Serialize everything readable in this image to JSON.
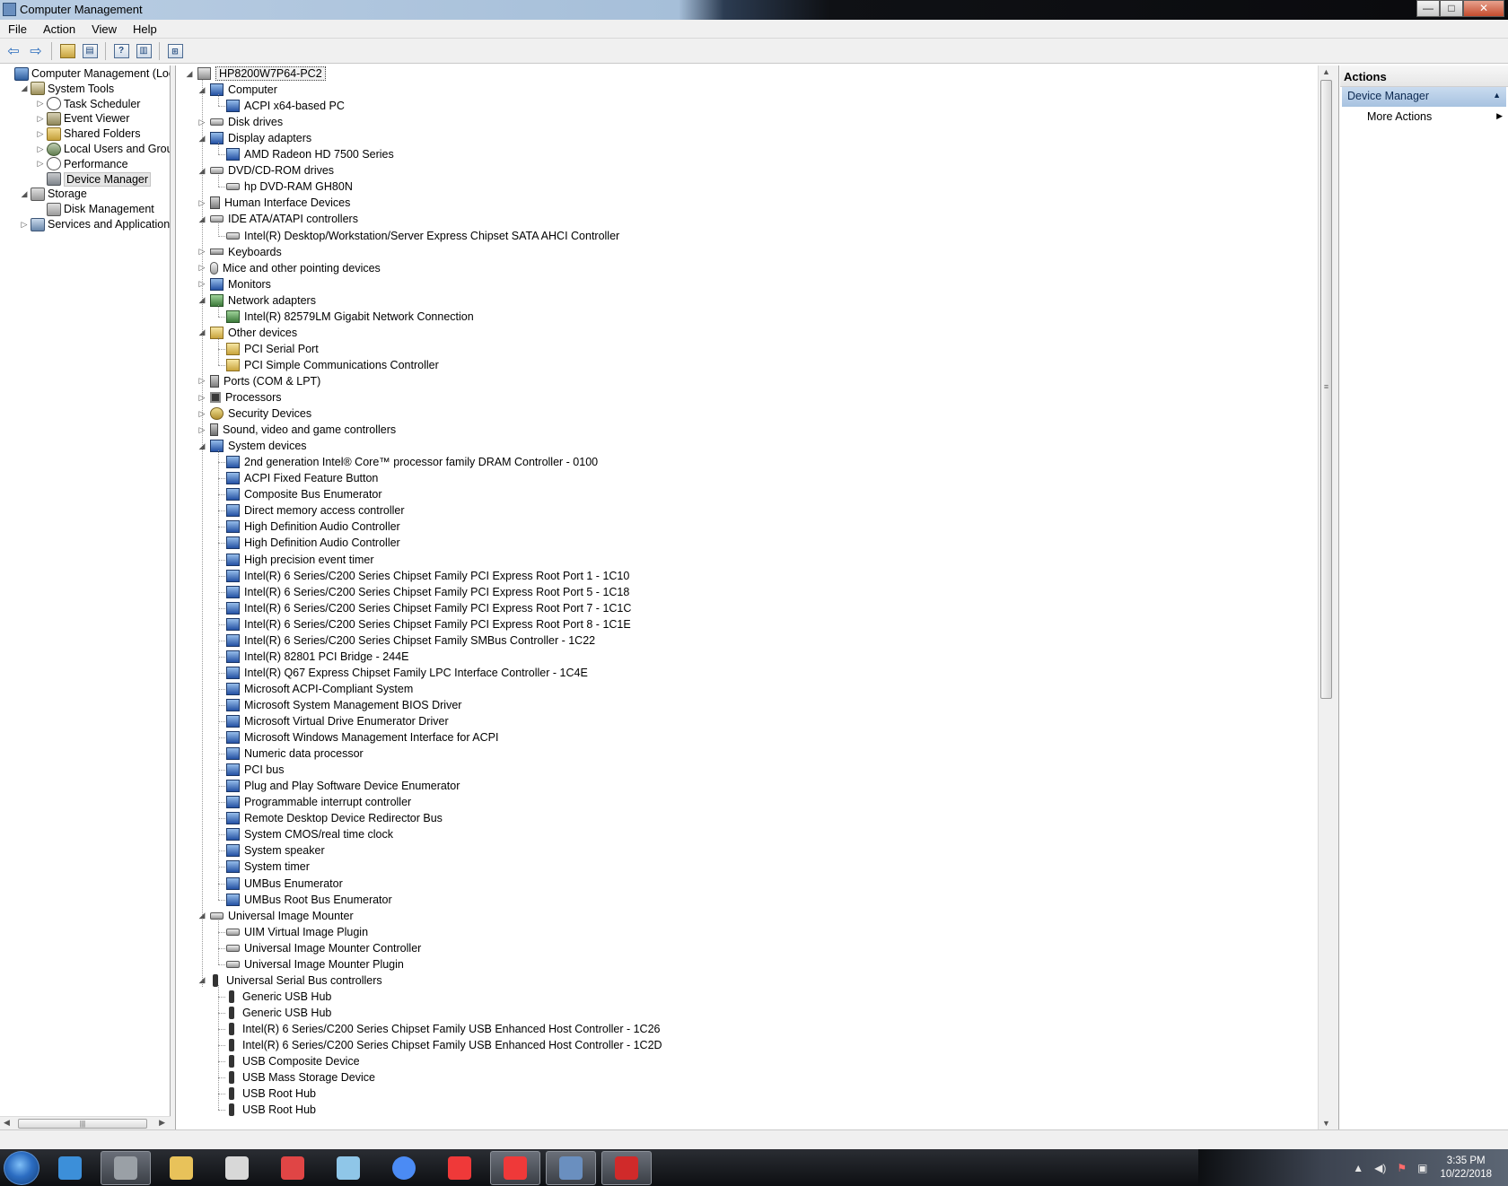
{
  "window": {
    "title": "Computer Management",
    "controls": {
      "minimize": "—",
      "maximize": "□",
      "close": "✕"
    }
  },
  "menu": [
    "File",
    "Action",
    "View",
    "Help"
  ],
  "toolbar": {
    "icons": [
      "back-arrow-icon",
      "forward-arrow-icon",
      "up-folder-icon",
      "show-hide-console-tree-icon",
      "help-icon",
      "show-hide-action-pane-icon",
      "scan-hardware-icon"
    ]
  },
  "left_tree": [
    {
      "label": "Computer Management (Local",
      "level": 0,
      "expander": "",
      "icon": "computer-management-icon"
    },
    {
      "label": "System Tools",
      "level": 1,
      "expander": "◢",
      "icon": "system-tools-icon"
    },
    {
      "label": "Task Scheduler",
      "level": 2,
      "expander": "▷",
      "icon": "task-scheduler-icon"
    },
    {
      "label": "Event Viewer",
      "level": 2,
      "expander": "▷",
      "icon": "event-viewer-icon"
    },
    {
      "label": "Shared Folders",
      "level": 2,
      "expander": "▷",
      "icon": "shared-folders-icon"
    },
    {
      "label": "Local Users and Groups",
      "level": 2,
      "expander": "▷",
      "icon": "local-users-icon"
    },
    {
      "label": "Performance",
      "level": 2,
      "expander": "▷",
      "icon": "performance-icon"
    },
    {
      "label": "Device Manager",
      "level": 2,
      "expander": "",
      "icon": "device-manager-icon",
      "selected": true
    },
    {
      "label": "Storage",
      "level": 1,
      "expander": "◢",
      "icon": "storage-icon"
    },
    {
      "label": "Disk Management",
      "level": 2,
      "expander": "",
      "icon": "disk-management-icon"
    },
    {
      "label": "Services and Applications",
      "level": 1,
      "expander": "▷",
      "icon": "services-icon"
    }
  ],
  "device_tree": {
    "root": "HP8200W7P64-PC2",
    "rows": [
      {
        "label": "Computer",
        "level": 1,
        "expander": "◢",
        "icon": "computer-icon"
      },
      {
        "label": "ACPI x64-based PC",
        "level": 2,
        "icon": "computer-icon"
      },
      {
        "label": "Disk drives",
        "level": 1,
        "expander": "▷",
        "icon": "disk-drive-icon"
      },
      {
        "label": "Display adapters",
        "level": 1,
        "expander": "◢",
        "icon": "display-adapter-icon"
      },
      {
        "label": "AMD Radeon HD 7500 Series",
        "level": 2,
        "icon": "display-adapter-icon"
      },
      {
        "label": "DVD/CD-ROM drives",
        "level": 1,
        "expander": "◢",
        "icon": "dvd-drive-icon"
      },
      {
        "label": "hp DVD-RAM GH80N",
        "level": 2,
        "icon": "dvd-drive-icon"
      },
      {
        "label": "Human Interface Devices",
        "level": 1,
        "expander": "▷",
        "icon": "hid-icon"
      },
      {
        "label": "IDE ATA/ATAPI controllers",
        "level": 1,
        "expander": "◢",
        "icon": "ide-controller-icon"
      },
      {
        "label": "Intel(R) Desktop/Workstation/Server Express Chipset SATA AHCI Controller",
        "level": 2,
        "icon": "ide-controller-icon"
      },
      {
        "label": "Keyboards",
        "level": 1,
        "expander": "▷",
        "icon": "keyboard-icon"
      },
      {
        "label": "Mice and other pointing devices",
        "level": 1,
        "expander": "▷",
        "icon": "mouse-icon"
      },
      {
        "label": "Monitors",
        "level": 1,
        "expander": "▷",
        "icon": "monitor-icon"
      },
      {
        "label": "Network adapters",
        "level": 1,
        "expander": "◢",
        "icon": "network-adapter-icon"
      },
      {
        "label": "Intel(R) 82579LM Gigabit Network Connection",
        "level": 2,
        "icon": "network-adapter-icon"
      },
      {
        "label": "Other devices",
        "level": 1,
        "expander": "◢",
        "icon": "other-devices-icon"
      },
      {
        "label": "PCI Serial Port",
        "level": 2,
        "icon": "unknown-device-icon"
      },
      {
        "label": "PCI Simple Communications Controller",
        "level": 2,
        "icon": "unknown-device-icon"
      },
      {
        "label": "Ports (COM & LPT)",
        "level": 1,
        "expander": "▷",
        "icon": "port-icon"
      },
      {
        "label": "Processors",
        "level": 1,
        "expander": "▷",
        "icon": "processor-icon"
      },
      {
        "label": "Security Devices",
        "level": 1,
        "expander": "▷",
        "icon": "security-device-icon"
      },
      {
        "label": "Sound, video and game controllers",
        "level": 1,
        "expander": "▷",
        "icon": "sound-icon"
      },
      {
        "label": "System devices",
        "level": 1,
        "expander": "◢",
        "icon": "system-device-icon"
      },
      {
        "label": "2nd generation Intel® Core™ processor family DRAM Controller - 0100",
        "level": 2,
        "icon": "system-device-icon"
      },
      {
        "label": "ACPI Fixed Feature Button",
        "level": 2,
        "icon": "system-device-icon"
      },
      {
        "label": "Composite Bus Enumerator",
        "level": 2,
        "icon": "system-device-icon"
      },
      {
        "label": "Direct memory access controller",
        "level": 2,
        "icon": "system-device-icon"
      },
      {
        "label": "High Definition Audio Controller",
        "level": 2,
        "icon": "system-device-icon"
      },
      {
        "label": "High Definition Audio Controller",
        "level": 2,
        "icon": "system-device-icon"
      },
      {
        "label": "High precision event timer",
        "level": 2,
        "icon": "system-device-icon"
      },
      {
        "label": "Intel(R) 6 Series/C200 Series Chipset Family PCI Express Root Port 1 - 1C10",
        "level": 2,
        "icon": "system-device-icon"
      },
      {
        "label": "Intel(R) 6 Series/C200 Series Chipset Family PCI Express Root Port 5 - 1C18",
        "level": 2,
        "icon": "system-device-icon"
      },
      {
        "label": "Intel(R) 6 Series/C200 Series Chipset Family PCI Express Root Port 7 - 1C1C",
        "level": 2,
        "icon": "system-device-icon"
      },
      {
        "label": "Intel(R) 6 Series/C200 Series Chipset Family PCI Express Root Port 8 - 1C1E",
        "level": 2,
        "icon": "system-device-icon"
      },
      {
        "label": "Intel(R) 6 Series/C200 Series Chipset Family SMBus Controller - 1C22",
        "level": 2,
        "icon": "system-device-icon"
      },
      {
        "label": "Intel(R) 82801 PCI Bridge - 244E",
        "level": 2,
        "icon": "system-device-icon"
      },
      {
        "label": "Intel(R) Q67 Express Chipset Family LPC Interface Controller - 1C4E",
        "level": 2,
        "icon": "system-device-icon"
      },
      {
        "label": "Microsoft ACPI-Compliant System",
        "level": 2,
        "icon": "system-device-icon"
      },
      {
        "label": "Microsoft System Management BIOS Driver",
        "level": 2,
        "icon": "system-device-icon"
      },
      {
        "label": "Microsoft Virtual Drive Enumerator Driver",
        "level": 2,
        "icon": "system-device-icon"
      },
      {
        "label": "Microsoft Windows Management Interface for ACPI",
        "level": 2,
        "icon": "system-device-icon"
      },
      {
        "label": "Numeric data processor",
        "level": 2,
        "icon": "system-device-icon"
      },
      {
        "label": "PCI bus",
        "level": 2,
        "icon": "system-device-icon"
      },
      {
        "label": "Plug and Play Software Device Enumerator",
        "level": 2,
        "icon": "system-device-icon"
      },
      {
        "label": "Programmable interrupt controller",
        "level": 2,
        "icon": "system-device-icon"
      },
      {
        "label": "Remote Desktop Device Redirector Bus",
        "level": 2,
        "icon": "system-device-icon"
      },
      {
        "label": "System CMOS/real time clock",
        "level": 2,
        "icon": "system-device-icon"
      },
      {
        "label": "System speaker",
        "level": 2,
        "icon": "system-device-icon"
      },
      {
        "label": "System timer",
        "level": 2,
        "icon": "system-device-icon"
      },
      {
        "label": "UMBus Enumerator",
        "level": 2,
        "icon": "system-device-icon"
      },
      {
        "label": "UMBus Root Bus Enumerator",
        "level": 2,
        "icon": "system-device-icon"
      },
      {
        "label": "Universal Image Mounter",
        "level": 1,
        "expander": "◢",
        "icon": "image-mounter-icon"
      },
      {
        "label": "UIM Virtual Image Plugin",
        "level": 2,
        "icon": "image-mounter-icon"
      },
      {
        "label": "Universal Image Mounter Controller",
        "level": 2,
        "icon": "image-mounter-icon"
      },
      {
        "label": "Universal Image Mounter Plugin",
        "level": 2,
        "icon": "image-mounter-icon"
      },
      {
        "label": "Universal Serial Bus controllers",
        "level": 1,
        "expander": "◢",
        "icon": "usb-icon"
      },
      {
        "label": "Generic USB Hub",
        "level": 2,
        "icon": "usb-icon"
      },
      {
        "label": "Generic USB Hub",
        "level": 2,
        "icon": "usb-icon"
      },
      {
        "label": "Intel(R) 6 Series/C200 Series Chipset Family USB Enhanced Host Controller - 1C26",
        "level": 2,
        "icon": "usb-icon"
      },
      {
        "label": "Intel(R) 6 Series/C200 Series Chipset Family USB Enhanced Host Controller - 1C2D",
        "level": 2,
        "icon": "usb-icon"
      },
      {
        "label": "USB Composite Device",
        "level": 2,
        "icon": "usb-icon"
      },
      {
        "label": "USB Mass Storage Device",
        "level": 2,
        "icon": "usb-icon"
      },
      {
        "label": "USB Root Hub",
        "level": 2,
        "icon": "usb-icon"
      },
      {
        "label": "USB Root Hub",
        "level": 2,
        "icon": "usb-icon"
      }
    ]
  },
  "actions": {
    "header": "Actions",
    "section": "Device Manager",
    "items": [
      "More Actions"
    ]
  },
  "taskbar": {
    "apps": [
      {
        "name": "media-player-icon",
        "color": "#3c8fd9"
      },
      {
        "name": "usb-drive-icon",
        "color": "#9aa0a6",
        "active": true
      },
      {
        "name": "file-explorer-icon",
        "color": "#e8c25a"
      },
      {
        "name": "paint-icon",
        "color": "#d8d8d8"
      },
      {
        "name": "snipping-tool-icon",
        "color": "#e04545"
      },
      {
        "name": "notepad-icon",
        "color": "#8fc6e8"
      },
      {
        "name": "chrome-icon",
        "color": "#4b8bf4"
      },
      {
        "name": "vivaldi-icon",
        "color": "#ef3939"
      },
      {
        "name": "vivaldi-icon",
        "color": "#ef3939",
        "active": true
      },
      {
        "name": "computer-management-icon",
        "color": "#6a8fbf",
        "active": true
      },
      {
        "name": "red-splat-icon",
        "color": "#d02a2a",
        "active": true
      }
    ],
    "tray_icons": [
      "show-hidden-icons-icon",
      "volume-icon",
      "action-center-icon",
      "network-icon"
    ],
    "clock_time": "3:35 PM",
    "clock_date": "10/22/2018"
  },
  "colors": {
    "actions_section_bg": "#b6cde6",
    "selected_node_bg": "#e5e5e5",
    "taskbar_bg": "#15181c"
  }
}
